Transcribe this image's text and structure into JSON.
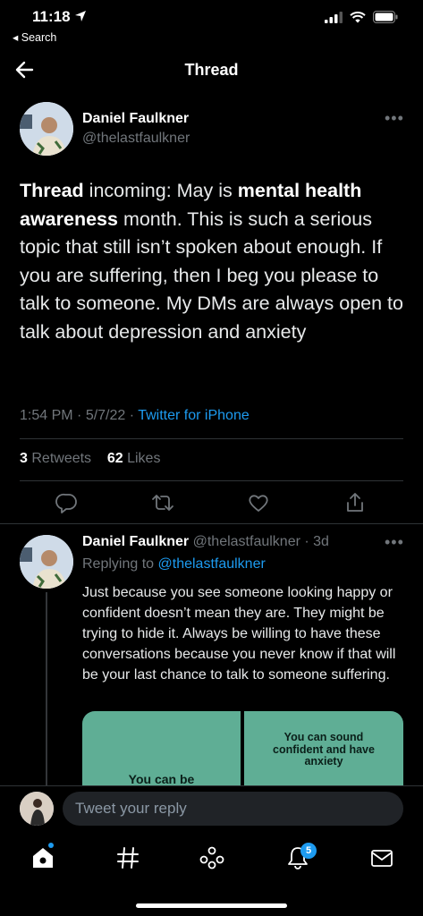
{
  "status_bar": {
    "time": "11:18",
    "back_label": "◂ Search"
  },
  "header": {
    "title": "Thread"
  },
  "main_tweet": {
    "name": "Daniel Faulkner",
    "handle": "@thelastfaulkner",
    "text_parts": {
      "p1_bold": "Thread",
      "p2": " incoming: May is ",
      "p3_bold": "mental health awareness",
      "p4": " month. This is such a serious topic that still isn’t spoken about enough. If you are suffering, then I beg you please to talk to someone. My DMs are always open to talk about depression and anxiety"
    },
    "time": "1:54 PM",
    "date": "5/7/22",
    "source": "Twitter for iPhone",
    "retweets_count": "3",
    "retweets_label": "Retweets",
    "likes_count": "62",
    "likes_label": "Likes"
  },
  "reply_tweet": {
    "name": "Daniel Faulkner",
    "handle": "@thelastfaulkner",
    "age": "3d",
    "replying_prefix": "Replying to",
    "replying_to": "@thelastfaulkner",
    "text": "Just because you see someone looking happy or confident doesn’t mean they are. They might be trying to hide it. Always be willing to have these conversations because you never know if that will be your last chance to talk to someone suffering.",
    "media_left_text": "You can be",
    "media_right_text": "You can sound confident and have anxiety"
  },
  "compose": {
    "placeholder": "Tweet your reply"
  },
  "tabbar": {
    "notifications_badge": "5"
  },
  "colors": {
    "accent": "#1d9bf0",
    "background": "#000000",
    "media": "#5fae95"
  }
}
